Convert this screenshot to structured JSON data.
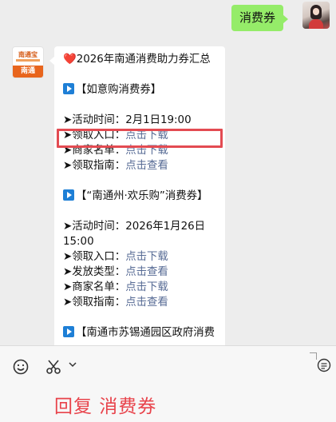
{
  "user_message": "消费券",
  "bot_avatar": {
    "logo_text": "南通宝",
    "badge": "南通"
  },
  "bot_message": {
    "title": "2026年南通消费助力券汇总",
    "section1": {
      "heading": "【如意购消费券】",
      "activity_time_label": "➤活动时间：",
      "activity_time": "2月1日19:00",
      "entry_label": "➤领取入口：",
      "entry_link": "点击下载",
      "merchants_label": "➤商家名单：",
      "merchants_link": "点击下载",
      "guide_label": "➤领取指南：",
      "guide_link": "点击查看"
    },
    "section2": {
      "heading": "【“南通州·欢乐购”消费券】",
      "activity_time_label": "➤活动时间：",
      "activity_time_line1": "2026年1月26日",
      "activity_time_line2": "15:00",
      "entry_label": "➤领取入口：",
      "entry_link": "点击下载",
      "type_label": "➤发放类型：",
      "type_link": "点击查看",
      "merchants_label": "➤商家名单：",
      "merchants_link": "点击下载",
      "guide_label": "➤领取指南：",
      "guide_link": "点击查看"
    },
    "section3": {
      "heading": "【南通市苏锡通园区政府消费"
    }
  },
  "input_bar": {
    "reply_text": "回复 消费券"
  },
  "colors": {
    "user_bubble": "#95ec69",
    "link": "#576b95",
    "highlight": "#e34b52",
    "reply": "#e8434b"
  }
}
